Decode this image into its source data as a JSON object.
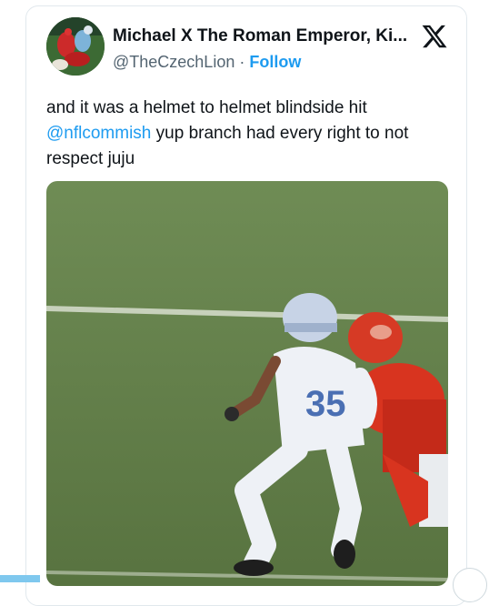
{
  "tweet": {
    "author_name": "Michael X The Roman Emperor, Ki...",
    "handle": "@TheCzechLion",
    "separator": " · ",
    "follow_label": "Follow",
    "text_part1": "and it was a helmet to helmet blindside hit ",
    "mention": "@nflcommish",
    "text_part2": " yup branch had every right to not respect juju"
  },
  "icons": {
    "platform": "x-logo-icon",
    "avatar": "avatar-image",
    "media": "video-frame-image"
  },
  "colors": {
    "text": "#0f1419",
    "secondary": "#536471",
    "link": "#1d9bf0",
    "field": "#5f7f48",
    "away_jersey": "#eef1f6",
    "home_jersey": "#d8341f"
  }
}
